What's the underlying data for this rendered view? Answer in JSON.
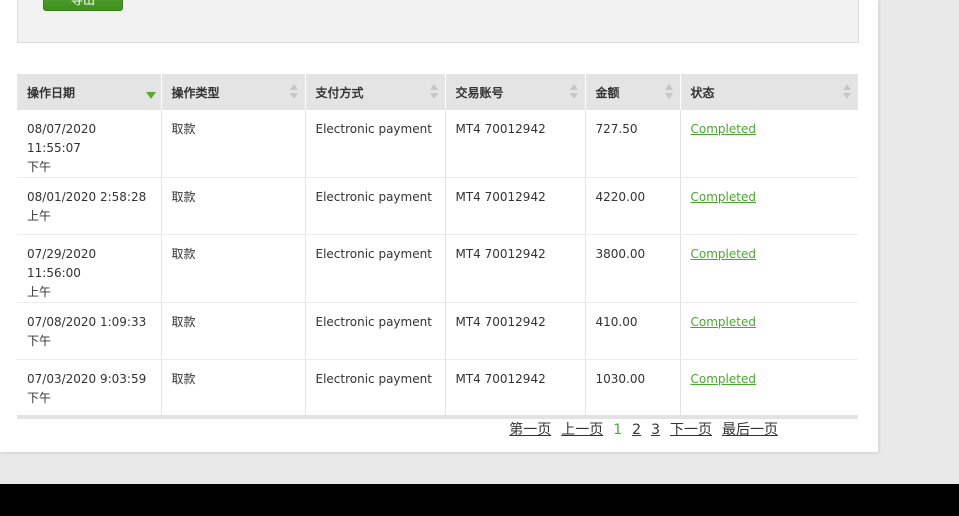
{
  "toolbar": {
    "export_label": "导出"
  },
  "table": {
    "headers": [
      "操作日期",
      "操作类型",
      "支付方式",
      "交易账号",
      "金额",
      "状态"
    ],
    "rows": [
      {
        "date": "08/07/2020 11:55:07",
        "ampm": "下午",
        "type": "取款",
        "method": "Electronic payment",
        "account": "MT4 70012942",
        "amount": "727.50",
        "status": "Completed"
      },
      {
        "date": "08/01/2020 2:58:28",
        "ampm": "上午",
        "type": "取款",
        "method": "Electronic payment",
        "account": "MT4 70012942",
        "amount": "4220.00",
        "status": "Completed"
      },
      {
        "date": "07/29/2020 11:56:00",
        "ampm": "上午",
        "type": "取款",
        "method": "Electronic payment",
        "account": "MT4 70012942",
        "amount": "3800.00",
        "status": "Completed"
      },
      {
        "date": "07/08/2020 1:09:33",
        "ampm": "下午",
        "type": "取款",
        "method": "Electronic payment",
        "account": "MT4 70012942",
        "amount": "410.00",
        "status": "Completed"
      },
      {
        "date": "07/03/2020 9:03:59",
        "ampm": "下午",
        "type": "取款",
        "method": "Electronic payment",
        "account": "MT4 70012942",
        "amount": "1030.00",
        "status": "Completed"
      }
    ]
  },
  "pager": {
    "first": "第一页",
    "prev": "上一页",
    "pages": [
      "1",
      "2",
      "3"
    ],
    "next": "下一页",
    "last": "最后一页"
  },
  "colors": {
    "accent": "#4aa82e",
    "header_bg": "#e4e4e4",
    "page_bg": "#e9e9e9",
    "taskbar": "#000000"
  },
  "icons": {
    "sort_active": "triangle-down-icon",
    "sort_inactive": "sort-arrows-icon"
  }
}
